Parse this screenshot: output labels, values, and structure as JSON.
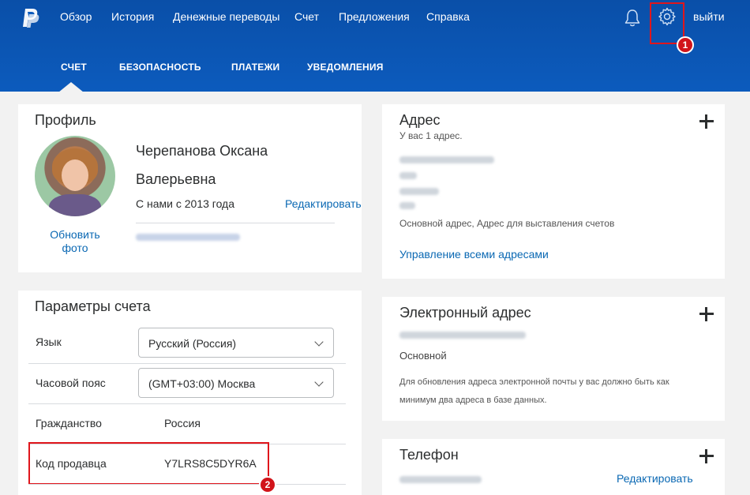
{
  "topnav": {
    "items": [
      "Обзор",
      "История",
      "Денежные переводы",
      "Счет",
      "Предложения",
      "Справка"
    ],
    "logout": "выйти",
    "badge_settings": "1"
  },
  "subnav": {
    "items": [
      "СЧЕТ",
      "БЕЗОПАСНОСТЬ",
      "ПЛАТЕЖИ",
      "УВЕДОМЛЕНИЯ"
    ],
    "active": "СЧЕТ"
  },
  "profile": {
    "title": "Профиль",
    "name_line1": "Черепанова Оксана",
    "name_line2": "Валерьевна",
    "since": "С нами с 2013 года",
    "edit": "Редактировать",
    "update_photo": "Обновить фото"
  },
  "account_params": {
    "title": "Параметры счета",
    "language_label": "Язык",
    "language_value": "Русский (Россия)",
    "timezone_label": "Часовой пояс",
    "timezone_value": "(GMT+03:00) Москва",
    "citizenship_label": "Гражданство",
    "citizenship_value": "Россия",
    "merchant_label": "Код продавца",
    "merchant_value": "Y7LRS8C5DYR6A",
    "badge_merchant": "2"
  },
  "address": {
    "title": "Адрес",
    "count": "У вас 1 адрес.",
    "type": "Основной адрес, Адрес для выставления счетов",
    "manage": "Управление всеми адресами"
  },
  "email": {
    "title": "Электронный адрес",
    "primary": "Основной",
    "note": "Для обновления адреса электронной почты у вас должно быть как минимум два адреса в базе данных."
  },
  "phone": {
    "title": "Телефон",
    "edit": "Редактировать"
  },
  "colors": {
    "header": "#0c5bbd",
    "highlight": "#e0161c",
    "link": "#0a68b3"
  }
}
